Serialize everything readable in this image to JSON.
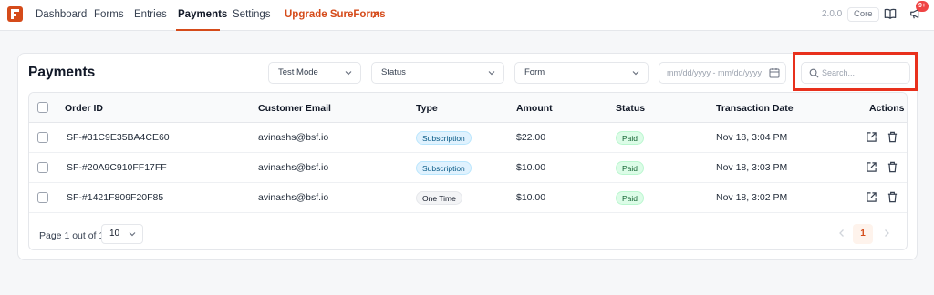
{
  "nav": {
    "items": [
      "Dashboard",
      "Forms",
      "Entries",
      "Payments",
      "Settings"
    ],
    "upgrade_label": "Upgrade SureForms",
    "upgrade_arrow": "↗",
    "version": "2.0.0",
    "plan_badge": "Core",
    "notifications_count": "9+"
  },
  "page": {
    "title": "Payments"
  },
  "filters": {
    "mode": "Test Mode",
    "status": "Status",
    "form": "Form",
    "date_placeholder": "mm/dd/yyyy - mm/dd/yyyy",
    "search_placeholder": "Search..."
  },
  "table": {
    "columns": [
      "Order ID",
      "Customer Email",
      "Type",
      "Amount",
      "Status",
      "Transaction Date",
      "Actions"
    ],
    "rows": [
      {
        "order_id": "SF-#31C9E35BA4CE60",
        "email": "avinashs@bsf.io",
        "type": "Subscription",
        "amount": "$22.00",
        "status": "Paid",
        "date": "Nov 18, 3:04 PM"
      },
      {
        "order_id": "SF-#20A9C910FF17FF",
        "email": "avinashs@bsf.io",
        "type": "Subscription",
        "amount": "$10.00",
        "status": "Paid",
        "date": "Nov 18, 3:03 PM"
      },
      {
        "order_id": "SF-#1421F809F20F85",
        "email": "avinashs@bsf.io",
        "type": "One Time",
        "amount": "$10.00",
        "status": "Paid",
        "date": "Nov 18, 3:02 PM"
      }
    ]
  },
  "pagination": {
    "summary": "Page 1 out of 1",
    "per_page": "10",
    "current_page": "1"
  },
  "colors": {
    "brand": "#d54b1a",
    "highlight": "#e8301c",
    "paid_bg": "#dcfce7",
    "subscription_bg": "#e0f2fe"
  },
  "icons": {
    "logo": "sureforms-logo-icon",
    "docs": "book-open-icon",
    "notifications": "megaphone-icon",
    "search": "search-icon",
    "calendar": "calendar-icon",
    "view": "external-link-icon",
    "delete": "trash-icon"
  }
}
